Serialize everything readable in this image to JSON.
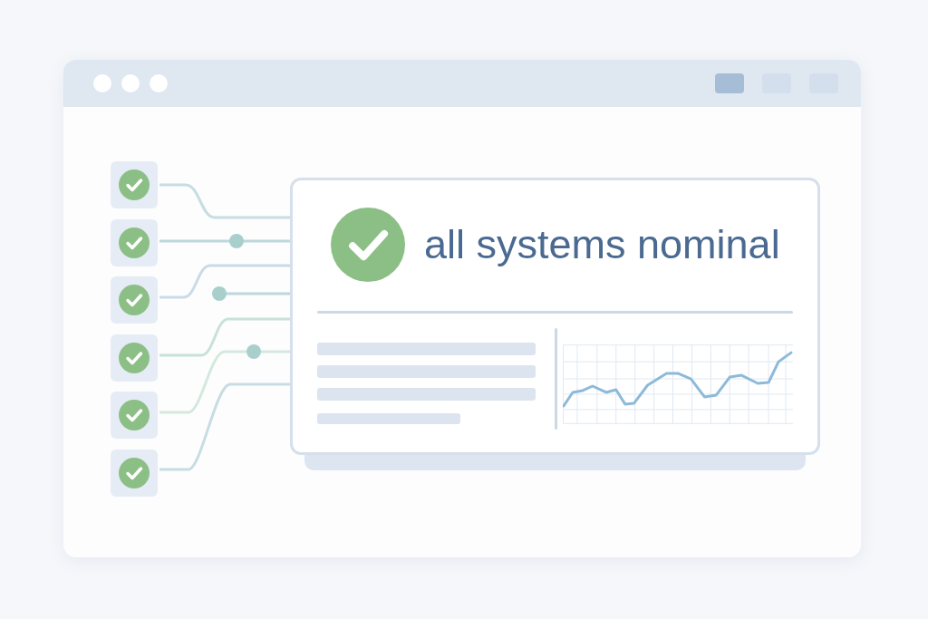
{
  "window": {
    "titlebar_buttons": [
      {
        "selected": true
      },
      {
        "selected": false
      },
      {
        "selected": false
      }
    ]
  },
  "checks": [
    {
      "checked": true
    },
    {
      "checked": true
    },
    {
      "checked": true
    },
    {
      "checked": true
    },
    {
      "checked": true
    },
    {
      "checked": true
    }
  ],
  "status_card": {
    "checked": true,
    "title": "all systems nominal"
  }
}
